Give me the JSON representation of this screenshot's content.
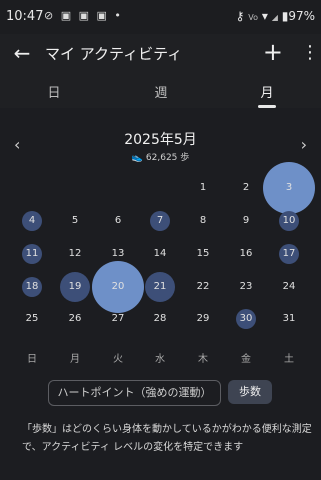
{
  "status": {
    "time": "10:47",
    "left_icons": "⊘ ▣ ▣ ▣ •",
    "battery": "97%"
  },
  "header": {
    "title": "マイ アクティビティ",
    "back_icon": "arrow-left-icon",
    "add_icon": "plus-icon",
    "more_icon": "more-vertical-icon"
  },
  "tabs": [
    {
      "label": "日"
    },
    {
      "label": "週"
    },
    {
      "label": "月"
    }
  ],
  "calendar": {
    "month_title": "2025年5月",
    "steps_total": "62,625 歩",
    "weekdays": [
      "日",
      "月",
      "火",
      "水",
      "木",
      "金",
      "土"
    ],
    "days": [
      {
        "d": "1",
        "level": 0
      },
      {
        "d": "2",
        "level": 0
      },
      {
        "d": "3",
        "level": 3
      },
      {
        "d": "4",
        "level": 1
      },
      {
        "d": "5",
        "level": 0
      },
      {
        "d": "6",
        "level": 0
      },
      {
        "d": "7",
        "level": 1
      },
      {
        "d": "8",
        "level": 0
      },
      {
        "d": "9",
        "level": 0
      },
      {
        "d": "10",
        "level": 1
      },
      {
        "d": "11",
        "level": 1
      },
      {
        "d": "12",
        "level": 0
      },
      {
        "d": "13",
        "level": 0
      },
      {
        "d": "14",
        "level": 0
      },
      {
        "d": "15",
        "level": 0
      },
      {
        "d": "16",
        "level": 0
      },
      {
        "d": "17",
        "level": 1
      },
      {
        "d": "18",
        "level": 1
      },
      {
        "d": "19",
        "level": 2
      },
      {
        "d": "20",
        "level": 3
      },
      {
        "d": "21",
        "level": 2
      },
      {
        "d": "22",
        "level": 0
      },
      {
        "d": "23",
        "level": 0
      },
      {
        "d": "24",
        "level": 0
      },
      {
        "d": "25",
        "level": 0
      },
      {
        "d": "26",
        "level": 0
      },
      {
        "d": "27",
        "level": 0
      },
      {
        "d": "28",
        "level": 0
      },
      {
        "d": "29",
        "level": 0
      },
      {
        "d": "30",
        "level": 1
      },
      {
        "d": "31",
        "level": 0
      }
    ]
  },
  "metrics": {
    "heart_points": "ハートポイント（強めの運動）",
    "steps": "歩数"
  },
  "description": "「歩数」はどのくらい身体を動かしているかがわかる便利な測定で、アクティビティ レベルの変化を特定できます"
}
